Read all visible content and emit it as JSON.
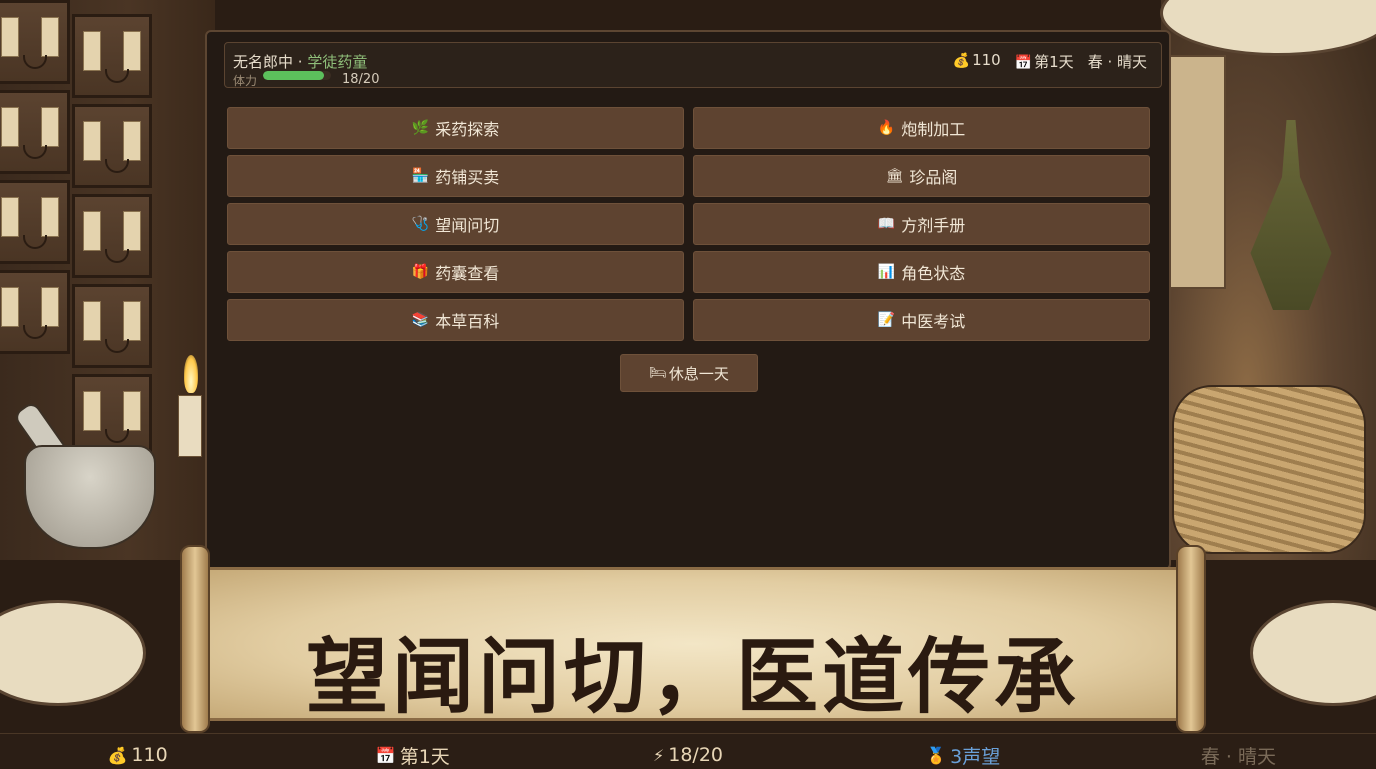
{
  "header": {
    "name": "无名郎中",
    "separator": " · ",
    "rank": "学徒药童",
    "stamina_label": "体力",
    "stamina_value": "18/20",
    "stamina_fraction": 0.9,
    "money": "110",
    "day": "第1天",
    "season_weather": "春 · 晴天"
  },
  "menu": [
    {
      "icon": "🌿",
      "label": "采药探索",
      "name": "herb-gathering-button"
    },
    {
      "icon": "🔥",
      "label": "炮制加工",
      "name": "processing-button"
    },
    {
      "icon": "🏪",
      "label": "药铺买卖",
      "name": "pharmacy-trade-button"
    },
    {
      "icon": "🏛",
      "label": "珍品阁",
      "name": "treasure-pavilion-button"
    },
    {
      "icon": "🩺",
      "label": "望闻问切",
      "name": "diagnosis-button"
    },
    {
      "icon": "📖",
      "label": "方剂手册",
      "name": "prescription-manual-button"
    },
    {
      "icon": "🎁",
      "label": "药囊查看",
      "name": "medicine-bag-button"
    },
    {
      "icon": "📊",
      "label": "角色状态",
      "name": "character-status-button"
    },
    {
      "icon": "📚",
      "label": "本草百科",
      "name": "herbal-encyclopedia-button"
    },
    {
      "icon": "📝",
      "label": "中医考试",
      "name": "tcm-exam-button"
    }
  ],
  "rest": {
    "icon": "🛏",
    "label": "休息一天"
  },
  "banner": {
    "slogan": "望闻问切，医道传承"
  },
  "statusbar": {
    "money": "110",
    "day": "第1天",
    "stamina": "18/20",
    "reputation": "3声望",
    "season_weather": "春 · 晴天"
  },
  "icons": {
    "money": "💰",
    "calendar": "📅",
    "stamina": "⚡",
    "reputation": "🏅"
  },
  "colors": {
    "accent_rank": "#8fbf7a",
    "stamina_bar": "#5cbf5c",
    "button_bg": "#5e4330",
    "reputation": "#6aa0d8"
  }
}
